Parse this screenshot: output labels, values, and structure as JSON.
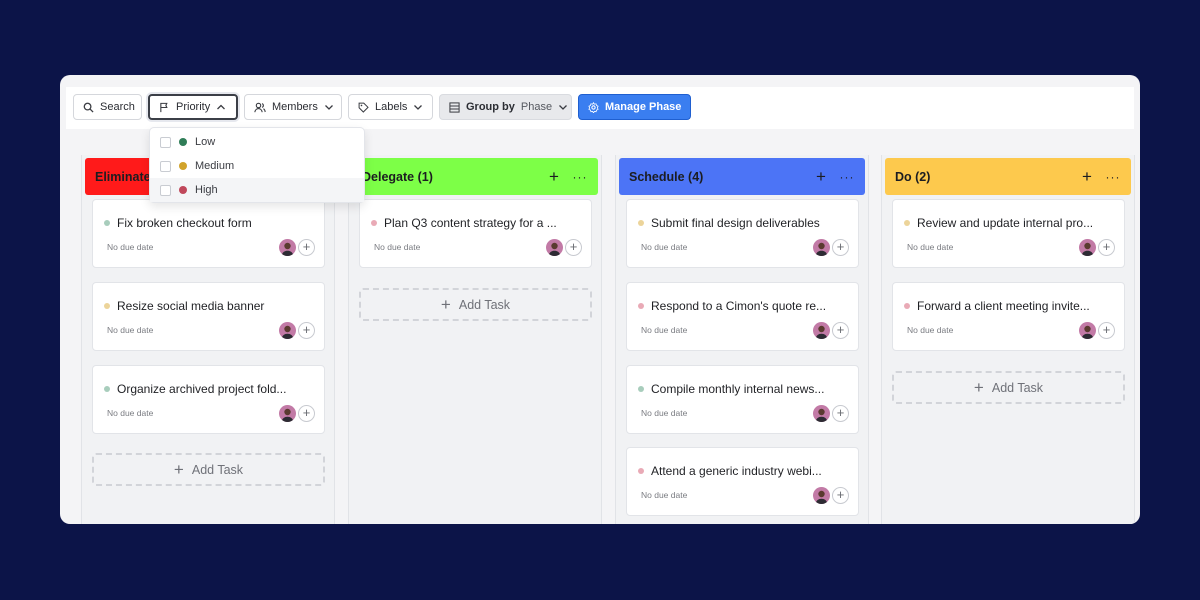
{
  "toolbar": {
    "search_label": "Search",
    "priority_label": "Priority",
    "members_label": "Members",
    "labels_label": "Labels",
    "group_by_label": "Group by",
    "group_by_value": "Phase",
    "manage_phase_label": "Manage Phase"
  },
  "priority_dropdown": {
    "options": [
      {
        "label": "Low",
        "color": "#2f7d57"
      },
      {
        "label": "Medium",
        "color": "#d1a32b"
      },
      {
        "label": "High",
        "color": "#c0485b"
      }
    ]
  },
  "priority_colors": {
    "low": "#a8cdbc",
    "medium": "#ecd49a",
    "high": "#e9aab6"
  },
  "columns": [
    {
      "title": "Eliminate",
      "color": "#ff1a1a",
      "tasks": [
        {
          "title": "Fix broken checkout form",
          "due": "No due date",
          "priority": "low"
        },
        {
          "title": "Resize social media banner",
          "due": "No due date",
          "priority": "medium"
        },
        {
          "title": "Organize archived project fold...",
          "due": "No due date",
          "priority": "low"
        }
      ],
      "add_task_label": "Add Task"
    },
    {
      "title": "Delegate (1)",
      "color": "#7dff47",
      "tasks": [
        {
          "title": "Plan Q3 content strategy for a ...",
          "due": "No due date",
          "priority": "high"
        }
      ],
      "add_task_label": "Add Task"
    },
    {
      "title": "Schedule (4)",
      "color": "#4c74f6",
      "tasks": [
        {
          "title": "Submit final design deliverables",
          "due": "No due date",
          "priority": "medium"
        },
        {
          "title": "Respond to a Cimon's quote re...",
          "due": "No due date",
          "priority": "high"
        },
        {
          "title": "Compile monthly internal news...",
          "due": "No due date",
          "priority": "low"
        },
        {
          "title": "Attend a generic industry webi...",
          "due": "No due date",
          "priority": "high"
        }
      ],
      "add_task_label": ""
    },
    {
      "title": "Do (2)",
      "color": "#fdc94d",
      "tasks": [
        {
          "title": "Review and update internal pro...",
          "due": "No due date",
          "priority": "medium"
        },
        {
          "title": "Forward a client meeting invite...",
          "due": "No due date",
          "priority": "high"
        }
      ],
      "add_task_label": "Add Task"
    }
  ]
}
